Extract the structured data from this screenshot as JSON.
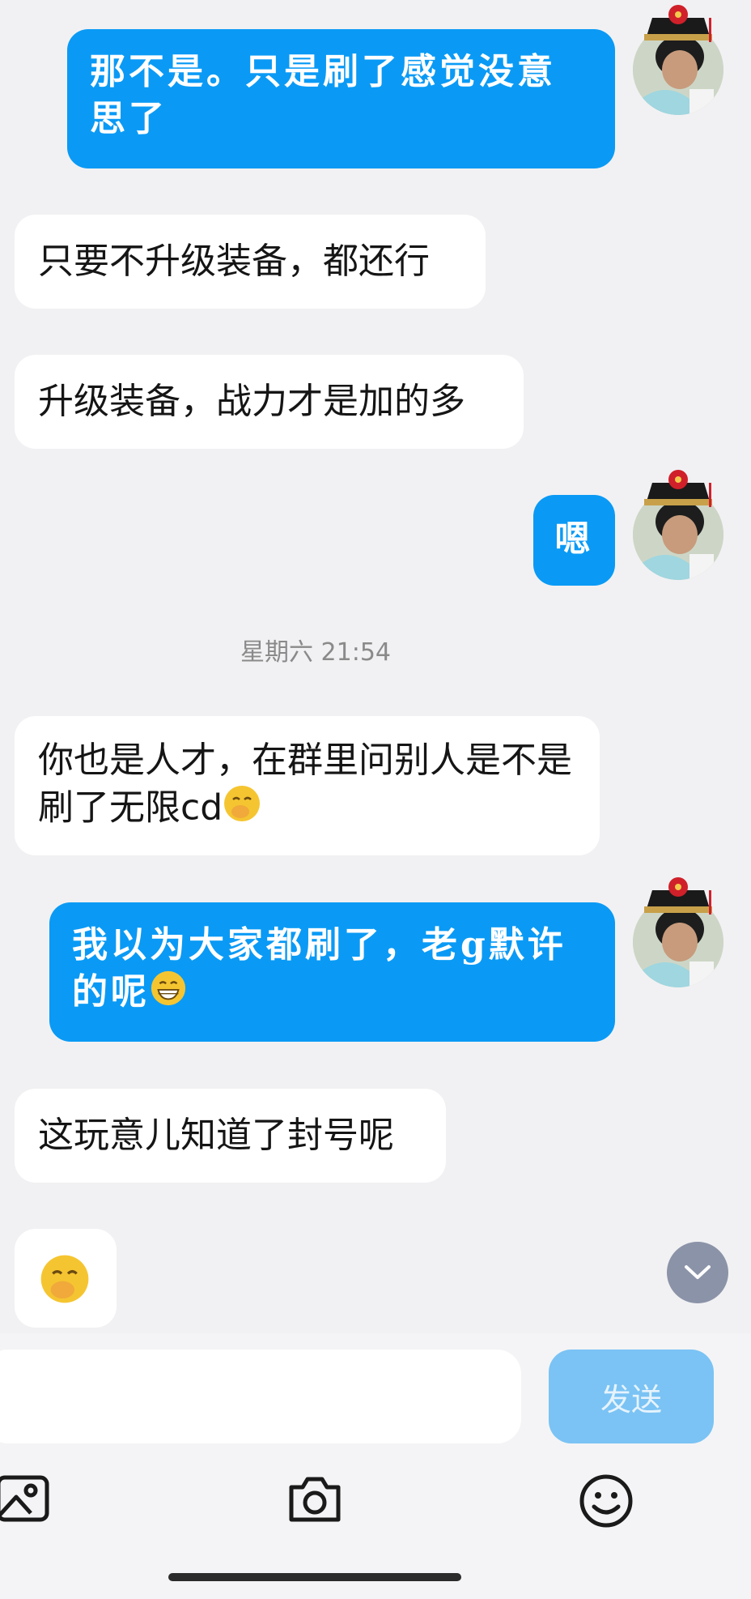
{
  "messages": [
    {
      "side": "out",
      "text": "那不是。只是刷了感觉没意思了"
    },
    {
      "side": "in",
      "text": "只要不升级装备，都还行"
    },
    {
      "side": "in",
      "text": "升级装备，战力才是加的多"
    },
    {
      "side": "out",
      "text": "嗯"
    },
    {
      "side": "time",
      "text": "星期六 21:54"
    },
    {
      "side": "in",
      "text": "你也是人才，在群里问别人是不是刷了无限cd",
      "emoji": "hand-over-mouth-emoji"
    },
    {
      "side": "out",
      "text": "我以为大家都刷了，老g默许的呢",
      "emoji": "grin-emoji"
    },
    {
      "side": "in",
      "text": "这玩意儿知道了封号呢"
    },
    {
      "side": "in",
      "text": "",
      "emoji": "hand-over-mouth-emoji"
    }
  ],
  "input": {
    "placeholder": "",
    "send_label": "发送"
  },
  "toolbar": {
    "icons": [
      "image-icon",
      "camera-icon",
      "smiley-icon"
    ]
  },
  "colors": {
    "background": "#f1f1f3",
    "outgoing_bubble": "#0a9af5",
    "incoming_bubble": "#ffffff",
    "send_button": "#7ac3f4"
  }
}
